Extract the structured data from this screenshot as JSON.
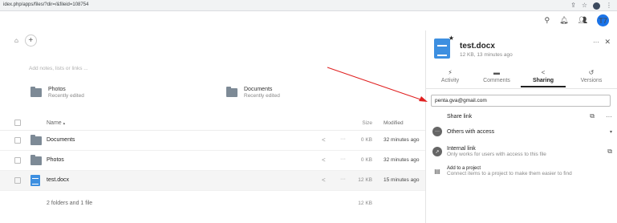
{
  "browser": {
    "url": "idex.php/apps/files/?dir=/&fileid=108754",
    "icons": [
      "share-icon",
      "star-icon",
      "extension-icon",
      "menu-icon"
    ]
  },
  "topbar": {
    "icons": [
      "search-icon",
      "notifications-icon",
      "contacts-icon"
    ],
    "avatar_initials": "T7"
  },
  "files": {
    "notes_placeholder": "Add notes, lists or links ...",
    "recent": [
      {
        "name": "Photos",
        "sub": "Recently edited"
      },
      {
        "name": "Documents",
        "sub": "Recently edited"
      }
    ],
    "columns": {
      "name": "Name",
      "sort_glyph": "▴",
      "size": "Size",
      "modified": "Modified"
    },
    "rows": [
      {
        "name": "Documents",
        "type": "folder",
        "size": "0 KB",
        "modified": "32 minutes ago"
      },
      {
        "name": "Photos",
        "type": "folder",
        "size": "0 KB",
        "modified": "32 minutes ago"
      },
      {
        "name": "test.docx",
        "type": "document",
        "size": "12 KB",
        "modified": "15 minutes ago"
      }
    ],
    "summary": {
      "text": "2 folders and 1 file",
      "size": "12 KB"
    }
  },
  "panel": {
    "title": "test.docx",
    "subtitle": "12 KB, 13 minutes ago",
    "tabs": [
      {
        "label": "Activity",
        "icon": "activity-icon"
      },
      {
        "label": "Comments",
        "icon": "comment-icon"
      },
      {
        "label": "Sharing",
        "icon": "share-icon",
        "active": true
      },
      {
        "label": "Versions",
        "icon": "history-icon"
      }
    ],
    "share_input_value": "penta.gva@gmail.com",
    "share_link_label": "Share link",
    "others_label": "Others with access",
    "internal_link_label": "Internal link",
    "internal_link_sub": "Only works for users with access to this file",
    "project_label": "Add to a project",
    "project_sub": "Connect items to a project to make them easier to find"
  },
  "annotation": {
    "arrow_color": "#e02020"
  }
}
